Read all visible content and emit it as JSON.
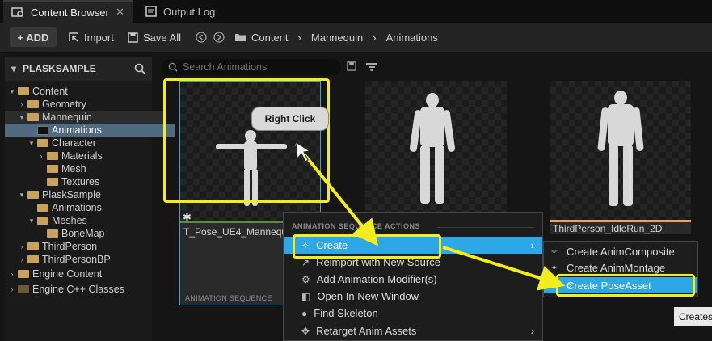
{
  "tabs": [
    {
      "label": "Content Browser",
      "close": "✕"
    },
    {
      "label": "Output Log"
    }
  ],
  "toolbar": {
    "add_label": "+ ADD",
    "import_label": "Import",
    "save_all_label": "Save All",
    "breadcrumb": [
      "Content",
      "Mannequin",
      "Animations"
    ],
    "separator": "›"
  },
  "sidebar": {
    "project_name": "PLASKSAMPLE",
    "items": [
      {
        "label": "Content",
        "depth": 0,
        "caret": "▾",
        "selected": false
      },
      {
        "label": "Geometry",
        "depth": 1,
        "caret": "›",
        "selected": false
      },
      {
        "label": "Mannequin",
        "depth": 1,
        "caret": "▾",
        "selected": false
      },
      {
        "label": "Animations",
        "depth": 2,
        "caret": "",
        "selected": true
      },
      {
        "label": "Character",
        "depth": 2,
        "caret": "▾",
        "selected": false
      },
      {
        "label": "Materials",
        "depth": 3,
        "caret": "›",
        "selected": false
      },
      {
        "label": "Mesh",
        "depth": 3,
        "caret": "",
        "selected": false
      },
      {
        "label": "Textures",
        "depth": 3,
        "caret": "",
        "selected": false
      },
      {
        "label": "PlaskSample",
        "depth": 1,
        "caret": "▾",
        "selected": false
      },
      {
        "label": "Animations",
        "depth": 2,
        "caret": "",
        "selected": false
      },
      {
        "label": "Meshes",
        "depth": 2,
        "caret": "▾",
        "selected": false
      },
      {
        "label": "BoneMap",
        "depth": 3,
        "caret": "",
        "selected": false
      },
      {
        "label": "ThirdPerson",
        "depth": 1,
        "caret": "›",
        "selected": false
      },
      {
        "label": "ThirdPersonBP",
        "depth": 1,
        "caret": "›",
        "selected": false
      }
    ],
    "engine_content": "Engine Content",
    "engine_cpp": "Engine C++ Classes"
  },
  "search": {
    "placeholder": "Search Animations"
  },
  "assets": [
    {
      "name": "T_Pose_UE4_Mannequin",
      "type": "ANIMATION SEQUENCE"
    },
    {
      "name": ""
    },
    {
      "name": "ThirdPerson_IdleRun_2D"
    }
  ],
  "callout": "Right Click",
  "context_menu": {
    "section_header": "ANIMATION SEQUENCE ACTIONS",
    "items": [
      {
        "label": "Create",
        "active": true,
        "submenu": true
      },
      {
        "label": "Reimport with New Source"
      },
      {
        "label": "Add Animation Modifier(s)"
      },
      {
        "label": "Open In New Window"
      },
      {
        "label": "Find Skeleton"
      },
      {
        "label": "Retarget Anim Assets",
        "submenu": true
      }
    ]
  },
  "submenu": {
    "items": [
      {
        "label": "Create AnimComposite"
      },
      {
        "label": "Create AnimMontage"
      },
      {
        "label": "Create PoseAsset",
        "active": true
      }
    ]
  },
  "tooltip": "Creates",
  "colors": {
    "highlight": "#f2ee1d",
    "menu_active": "#2ea7e6",
    "folder": "#c8a360",
    "selected_row": "#4e6b82"
  }
}
